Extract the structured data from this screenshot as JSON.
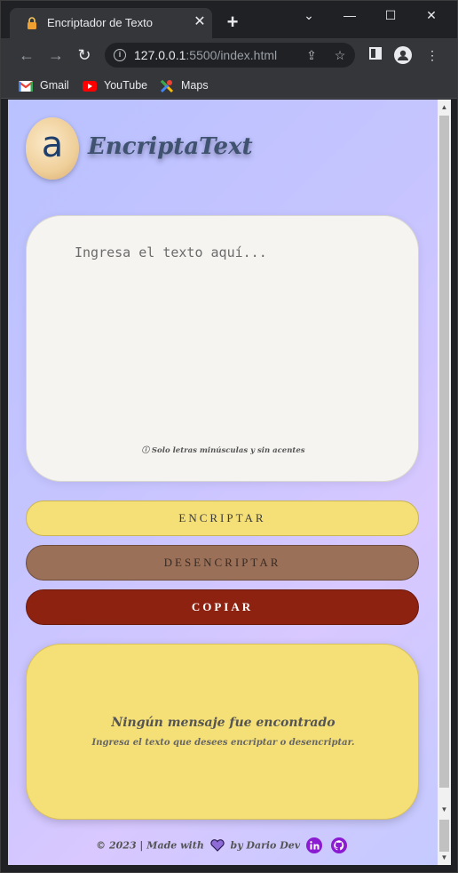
{
  "browser": {
    "tab_title": "Encriptador de Texto",
    "url_host": "127.0.0.1",
    "url_rest": ":5500/index.html",
    "bookmarks": [
      "Gmail",
      "YouTube",
      "Maps"
    ]
  },
  "app": {
    "logo_letter": "a",
    "brand": "EncriptaText",
    "textarea_placeholder": "Ingresa el texto aquí...",
    "hint": "ⓘ Solo letras minúsculas y sin acentes",
    "buttons": {
      "encrypt": "ENCRIPTAR",
      "decrypt": "DESENCRIPTAR",
      "copy": "COPIAR"
    },
    "result": {
      "title": "Ningún mensaje fue encontrado",
      "subtitle": "Ingresa el texto que desees encriptar o desencriptar."
    },
    "footer": {
      "prefix": "© 2023 | Made with",
      "suffix": "by Dario Dev"
    }
  },
  "colors": {
    "encrypt_bg": "#f5df77",
    "decrypt_bg": "#9b7058",
    "copy_bg": "#8e2210",
    "result_bg": "#f5df77"
  }
}
